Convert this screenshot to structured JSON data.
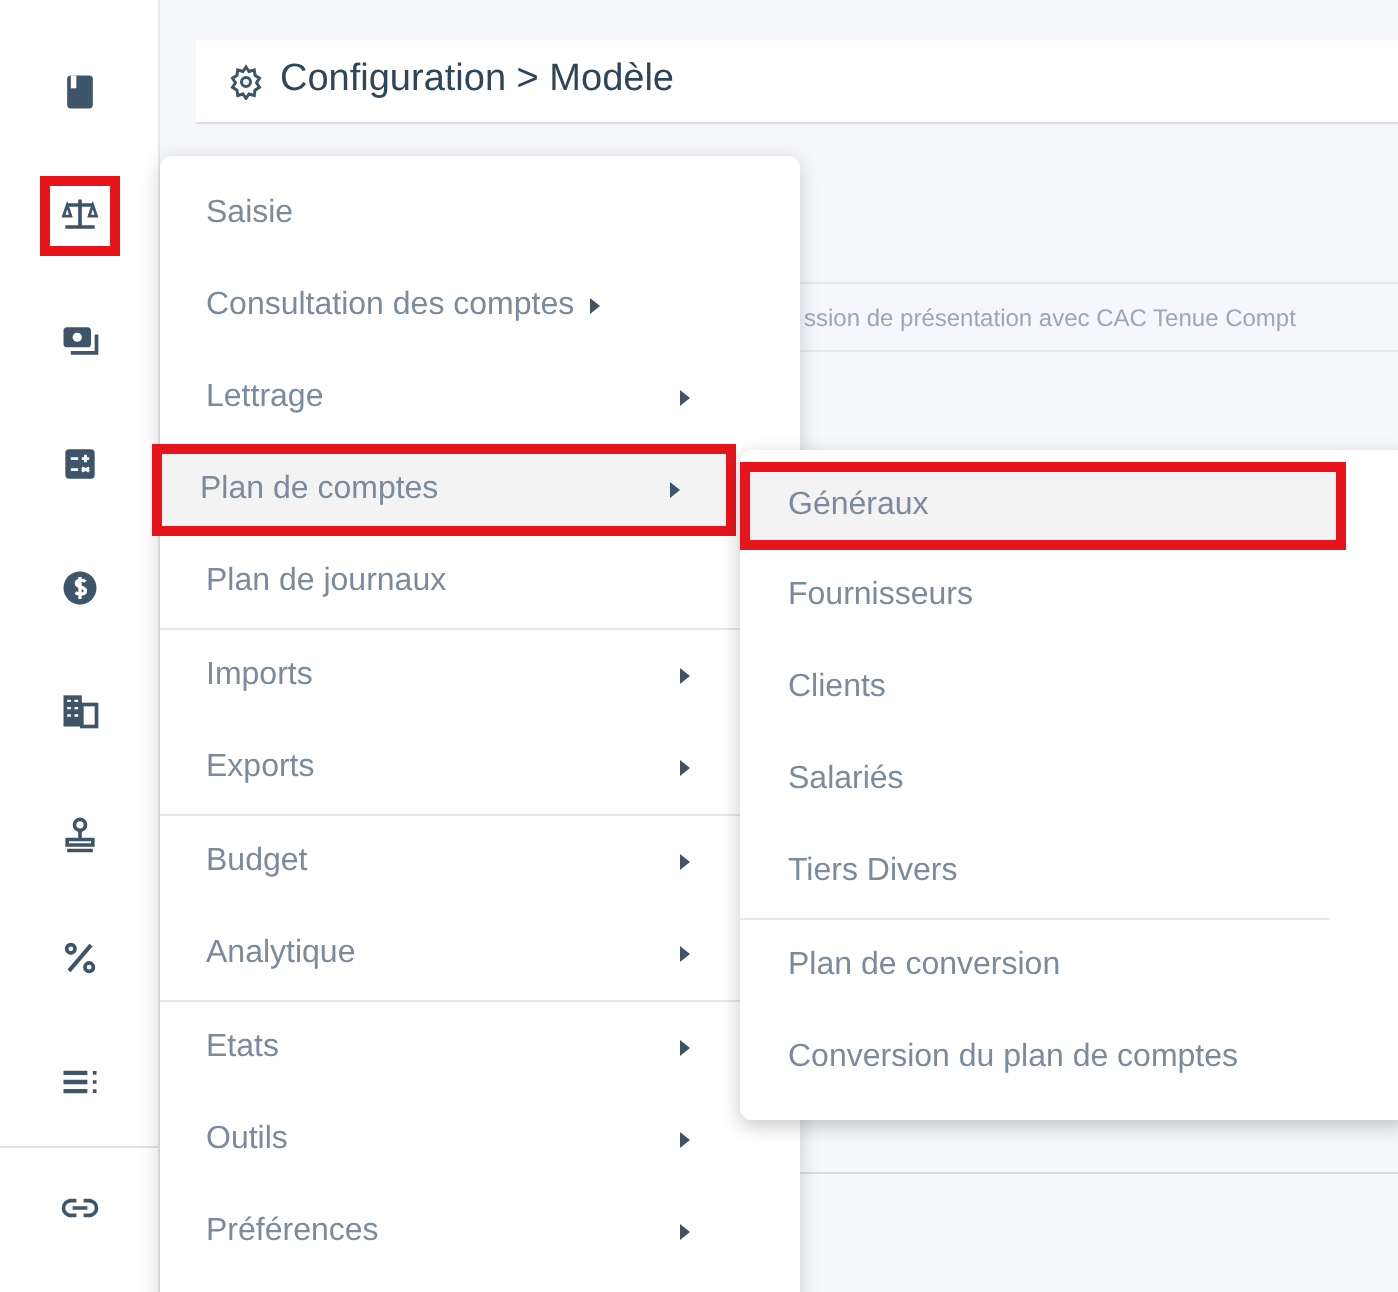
{
  "sidebar": {
    "items": [
      {
        "kind": "book",
        "selected": false
      },
      {
        "kind": "balance",
        "selected": true
      },
      {
        "kind": "money",
        "selected": false
      },
      {
        "kind": "calculator",
        "selected": false
      },
      {
        "kind": "dollar",
        "selected": false
      },
      {
        "kind": "building",
        "selected": false
      },
      {
        "kind": "stamp",
        "selected": false
      },
      {
        "kind": "percent",
        "selected": false
      },
      {
        "kind": "list",
        "selected": false
      }
    ],
    "footer_items": [
      {
        "kind": "link",
        "selected": false
      }
    ]
  },
  "header": {
    "title": "Configuration > Modèle"
  },
  "background_row": {
    "text": "ssion de présentation avec CAC Tenue Compt"
  },
  "menu": {
    "groups": [
      [
        {
          "label": "Saisie",
          "has_submenu": false,
          "selected": false
        },
        {
          "label": "Consultation des comptes",
          "has_submenu": true,
          "selected": false
        },
        {
          "label": "Lettrage",
          "has_submenu": true,
          "selected": false
        },
        {
          "label": "Plan de comptes",
          "has_submenu": true,
          "selected": true
        },
        {
          "label": "Plan de journaux",
          "has_submenu": false,
          "selected": false
        }
      ],
      [
        {
          "label": "Imports",
          "has_submenu": true,
          "selected": false
        },
        {
          "label": "Exports",
          "has_submenu": true,
          "selected": false
        }
      ],
      [
        {
          "label": "Budget",
          "has_submenu": true,
          "selected": false
        },
        {
          "label": "Analytique",
          "has_submenu": true,
          "selected": false
        }
      ],
      [
        {
          "label": "Etats",
          "has_submenu": true,
          "selected": false
        },
        {
          "label": "Outils",
          "has_submenu": true,
          "selected": false
        },
        {
          "label": "Préférences",
          "has_submenu": true,
          "selected": false
        }
      ]
    ]
  },
  "submenu": {
    "groups": [
      [
        {
          "label": "Généraux",
          "selected": true
        },
        {
          "label": "Fournisseurs",
          "selected": false
        },
        {
          "label": "Clients",
          "selected": false
        },
        {
          "label": "Salariés",
          "selected": false
        },
        {
          "label": "Tiers Divers",
          "selected": false
        }
      ],
      [
        {
          "label": "Plan de conversion",
          "selected": false
        },
        {
          "label": "Conversion du plan de comptes",
          "selected": false
        }
      ]
    ]
  }
}
